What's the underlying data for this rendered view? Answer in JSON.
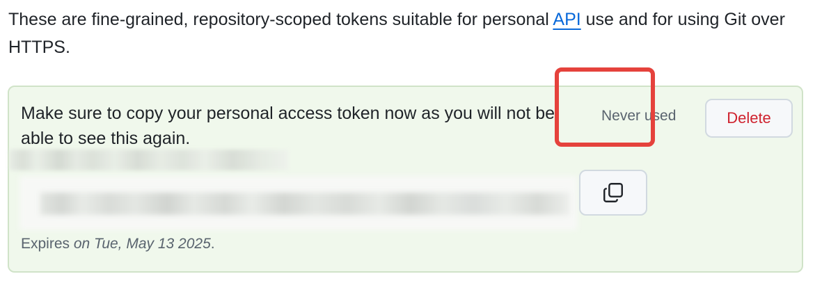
{
  "intro": {
    "text_before": "These are fine-grained, repository-scoped tokens suitable for personal ",
    "link_text": "API",
    "text_after": " use and for using Git over HTTPS."
  },
  "token_card": {
    "notice": "Make sure to copy your personal access token now as you will not be able to see this again.",
    "usage_status": "Never used",
    "delete_label": "Delete",
    "expires_prefix": "Expires ",
    "expires_date": "on Tue, May 13 2025",
    "expires_suffix": ".",
    "copy_icon": "copy-icon"
  },
  "colors": {
    "card_background": "#f0f8ec",
    "delete_text": "#cf222e",
    "link": "#0969da",
    "highlight_border": "#e5423c"
  }
}
